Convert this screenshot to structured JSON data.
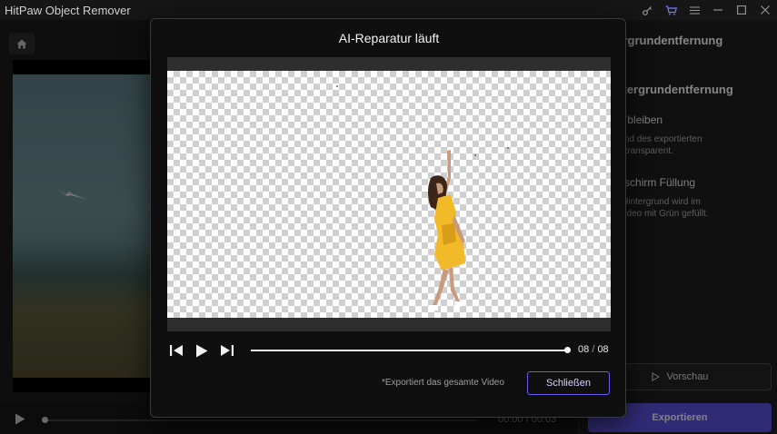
{
  "app": {
    "title": "HitPaw Object Remover"
  },
  "window_icons": [
    "key-icon",
    "cart-icon",
    "menu-icon",
    "minimize-icon",
    "maximize-icon",
    "close-icon"
  ],
  "player": {
    "time_current": "00:00",
    "time_total": "00:03"
  },
  "right_panel": {
    "title": "Hintergrundentfernung",
    "subtitle": "it Hintergrundentfernung",
    "options": [
      {
        "title": "parent bleiben",
        "desc": "intergrund des exportierten\ns bleibt transparent."
      },
      {
        "title": "er Bildschirm Füllung",
        "desc": "tfernte Hintergrund wird im\nierten Video mit Grün gefüllt."
      }
    ],
    "preview_label": "Vorschau",
    "export_label": "Exportieren"
  },
  "modal": {
    "title": "AI-Reparatur läuft",
    "progress": 1.0,
    "frame_current": "08",
    "frame_total": "08",
    "footnote": "*Exportiert das gesamte Video",
    "close_label": "Schließen"
  },
  "colors": {
    "accent": "#5a4fd8",
    "accent_border": "#6a5cf0",
    "cart": "#6f7dff",
    "dress": "#f2b929"
  }
}
